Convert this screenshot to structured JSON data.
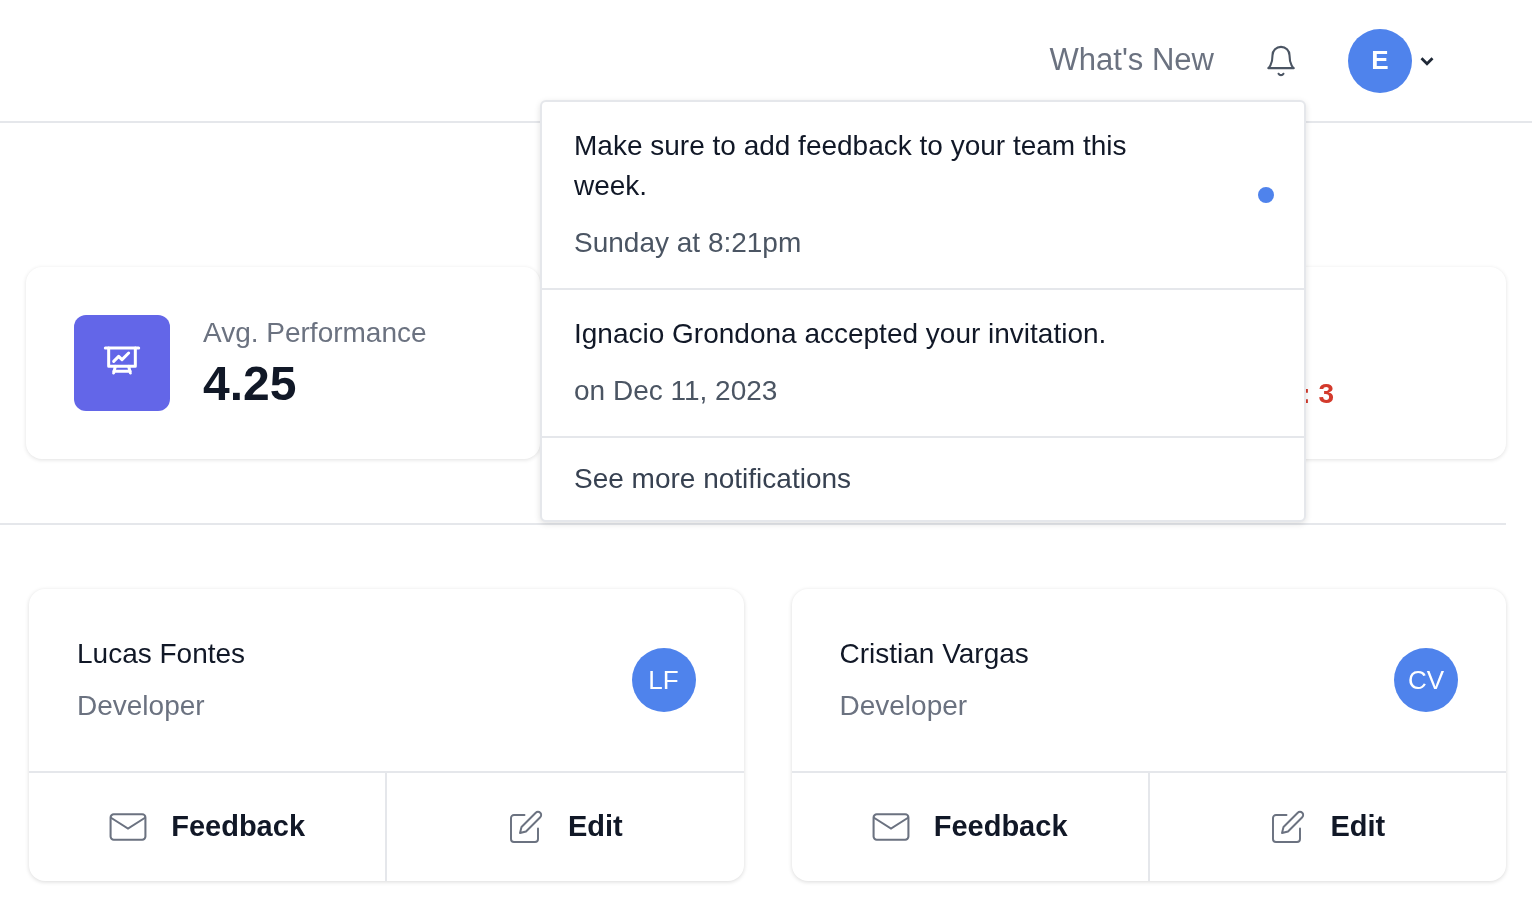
{
  "header": {
    "whats_new": "What's New",
    "avatar": "E"
  },
  "notifications": {
    "items": [
      {
        "message": "Make sure to add feedback to your team this week.",
        "time": "Sunday at 8:21pm",
        "unread": true
      },
      {
        "message": "Ignacio Grondona accepted your invitation.",
        "time": "on Dec 11, 2023",
        "unread": false
      }
    ],
    "see_more": "See more notifications"
  },
  "stats": [
    {
      "label": "Avg. Performance",
      "value": "4.25"
    },
    {
      "partial": ": 3"
    }
  ],
  "members": [
    {
      "name": "Lucas Fontes",
      "role": "Developer",
      "initials": "LF",
      "actions": [
        "Feedback",
        "Edit"
      ]
    },
    {
      "name": "Cristian Vargas",
      "role": "Developer",
      "initials": "CV",
      "actions": [
        "Feedback",
        "Edit"
      ]
    }
  ]
}
